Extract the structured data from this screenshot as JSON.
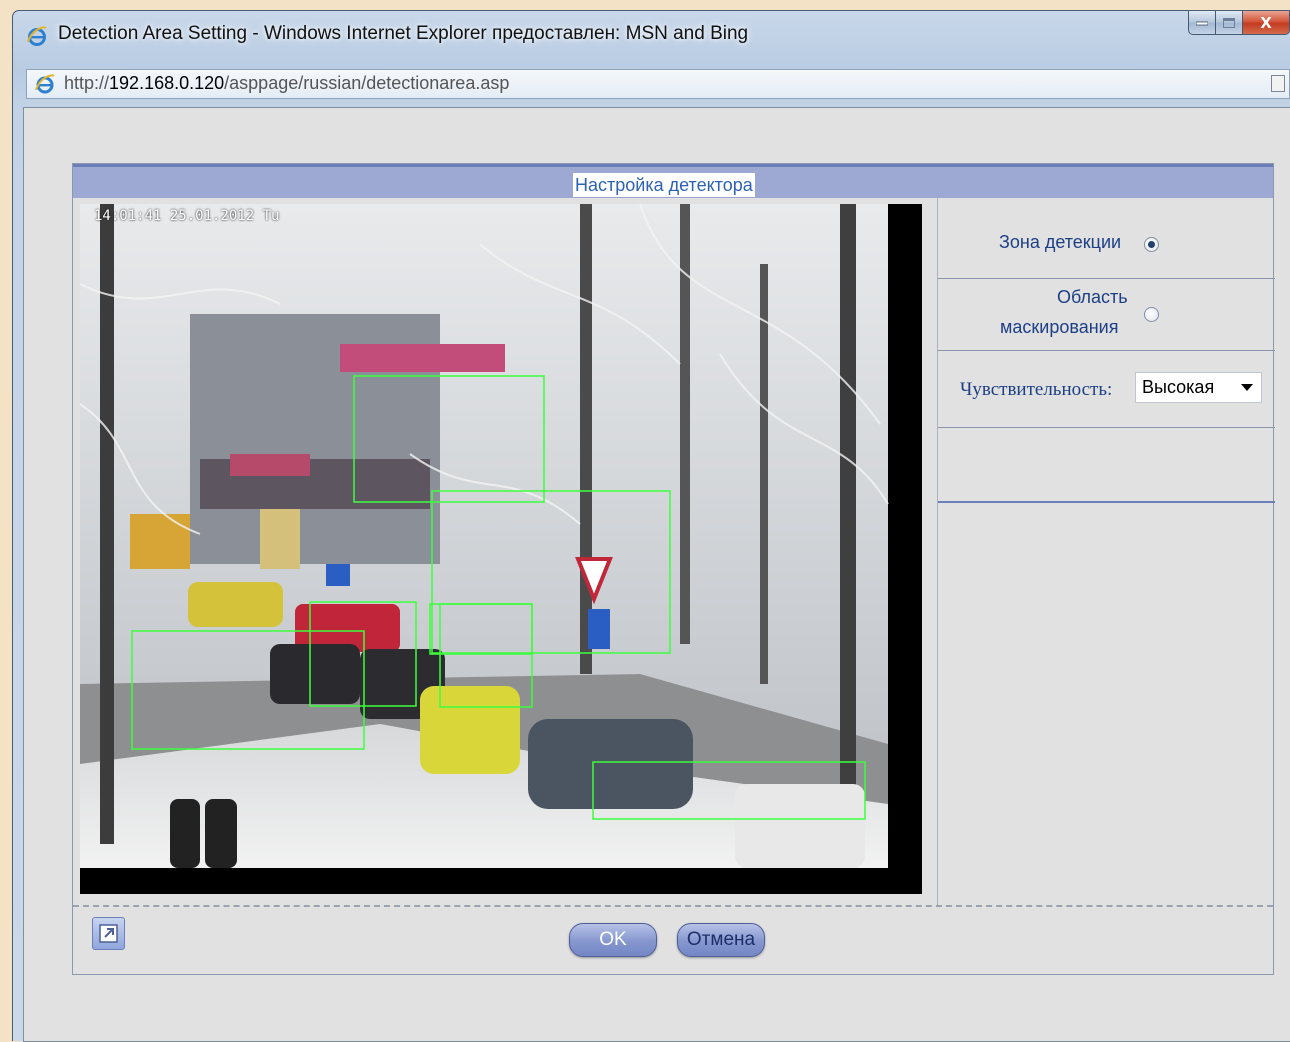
{
  "window": {
    "title": "Detection Area Setting - Windows Internet Explorer предоставлен: MSN and Bing",
    "close_label": "X"
  },
  "address": {
    "prefix": "http://",
    "host": "192.168.0.120",
    "path": "/asppage/russian/detectionarea.asp"
  },
  "panel": {
    "title": "Настройка детектора"
  },
  "video": {
    "timestamp": "14:01:41 25.01.2012 Tu",
    "detection_boxes": 7
  },
  "options": {
    "detection_zone_label": "Зона детекции",
    "detection_zone_selected": true,
    "mask_area_line1": "Область",
    "mask_area_line2": "маскирования",
    "mask_area_selected": false,
    "sensitivity_label": "Чувствительность:",
    "sensitivity_value": "Высокая"
  },
  "buttons": {
    "ok": "OK",
    "cancel": "Отмена"
  },
  "colors": {
    "accent": "#9ea9d3",
    "label_text": "#1d3f86",
    "detection_box": "#3cff3c"
  },
  "icons": {
    "browser": "ie-logo-icon",
    "popout": "popout-icon",
    "page": "page-icon"
  }
}
